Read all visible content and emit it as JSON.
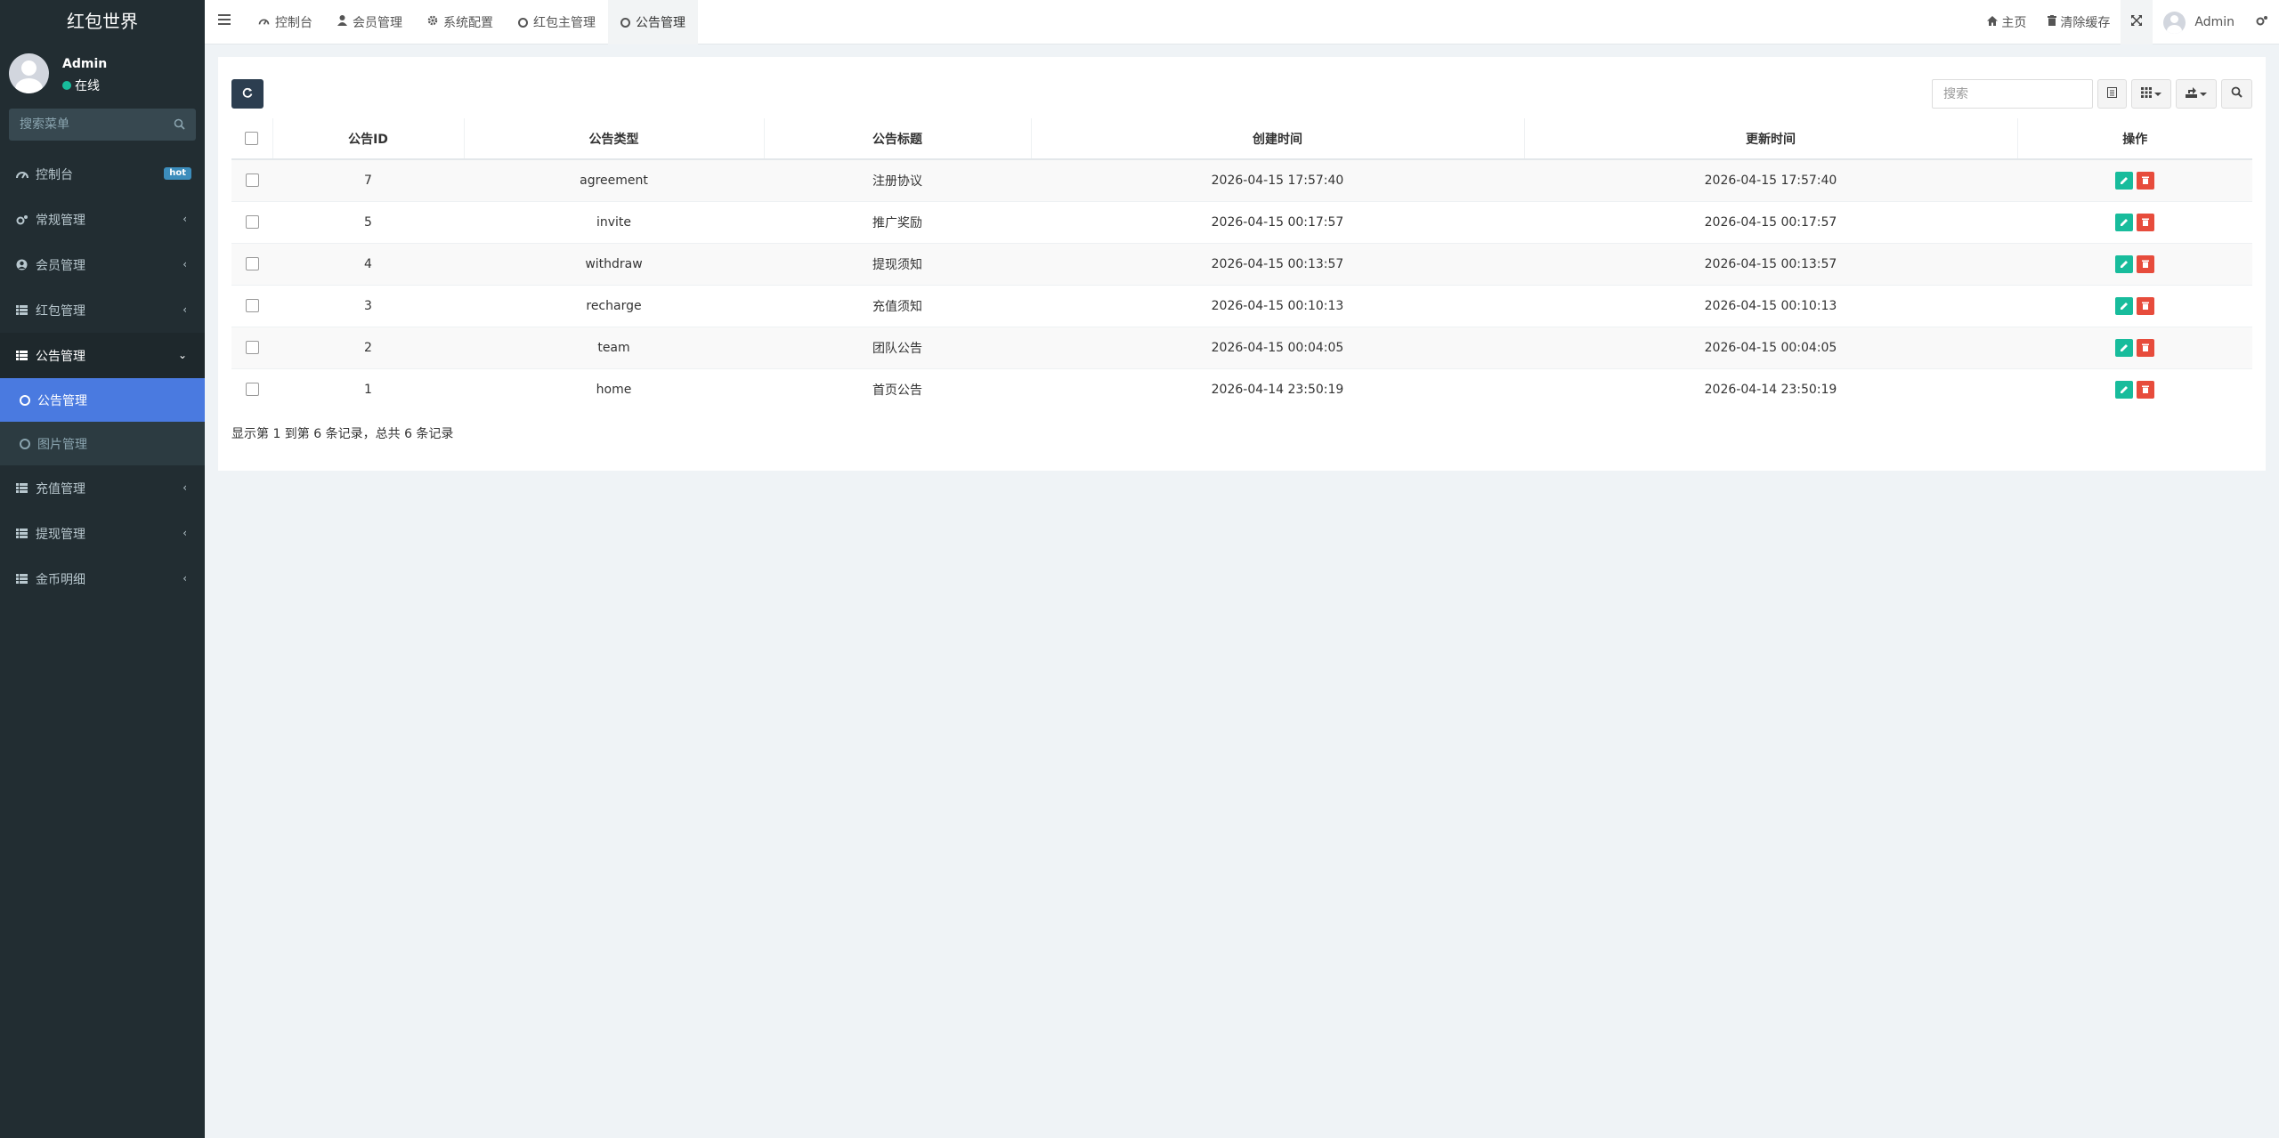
{
  "app": {
    "logo": "红包世界"
  },
  "user": {
    "name": "Admin",
    "status": "在线"
  },
  "sidebar": {
    "search_placeholder": "搜索菜单",
    "items": [
      {
        "label": "控制台",
        "badge": "hot"
      },
      {
        "label": "常规管理"
      },
      {
        "label": "会员管理"
      },
      {
        "label": "红包管理"
      },
      {
        "label": "公告管理"
      },
      {
        "label": "充值管理"
      },
      {
        "label": "提现管理"
      },
      {
        "label": "金币明细"
      }
    ],
    "sub_items": [
      {
        "label": "公告管理"
      },
      {
        "label": "图片管理"
      }
    ]
  },
  "header": {
    "tabs": [
      {
        "label": "控制台"
      },
      {
        "label": "会员管理"
      },
      {
        "label": "系统配置"
      },
      {
        "label": "红包主管理"
      },
      {
        "label": "公告管理"
      }
    ],
    "right": {
      "home": "主页",
      "clear_cache": "清除缓存",
      "admin": "Admin"
    }
  },
  "toolbar": {
    "search_placeholder": "搜索"
  },
  "table": {
    "headers": [
      "公告ID",
      "公告类型",
      "公告标题",
      "创建时间",
      "更新时间",
      "操作"
    ],
    "rows": [
      {
        "id": "7",
        "type": "agreement",
        "title": "注册协议",
        "created": "2026-04-15 17:57:40",
        "updated": "2026-04-15 17:57:40"
      },
      {
        "id": "5",
        "type": "invite",
        "title": "推广奖励",
        "created": "2026-04-15 00:17:57",
        "updated": "2026-04-15 00:17:57"
      },
      {
        "id": "4",
        "type": "withdraw",
        "title": "提现须知",
        "created": "2026-04-15 00:13:57",
        "updated": "2026-04-15 00:13:57"
      },
      {
        "id": "3",
        "type": "recharge",
        "title": "充值须知",
        "created": "2026-04-15 00:10:13",
        "updated": "2026-04-15 00:10:13"
      },
      {
        "id": "2",
        "type": "team",
        "title": "团队公告",
        "created": "2026-04-15 00:04:05",
        "updated": "2026-04-15 00:04:05"
      },
      {
        "id": "1",
        "type": "home",
        "title": "首页公告",
        "created": "2026-04-14 23:50:19",
        "updated": "2026-04-14 23:50:19"
      }
    ],
    "summary": "显示第 1 到第 6 条记录，总共 6 条记录"
  },
  "colors": {
    "sidebar_bg": "#222d32",
    "active_item": "#4a7ae0",
    "edit": "#18bc9c",
    "delete": "#e74c3c",
    "online": "#18bc9c"
  }
}
